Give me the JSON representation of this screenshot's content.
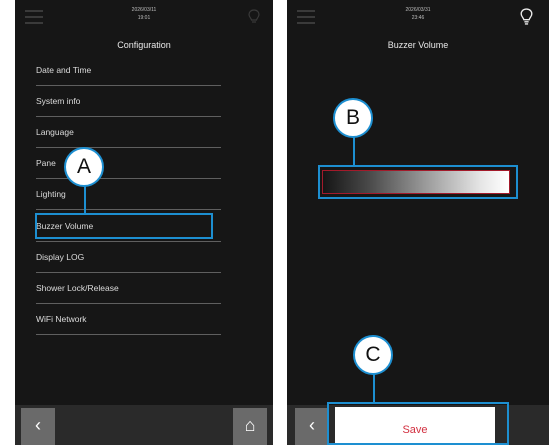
{
  "colors": {
    "accent": "#1d8fd1",
    "save_text": "#d23040",
    "background": "#161616"
  },
  "left_screen": {
    "date": "2026/03/11",
    "time": "19:01",
    "title": "Configuration",
    "menu": [
      {
        "label": "Date and Time"
      },
      {
        "label": "System info"
      },
      {
        "label": "Language"
      },
      {
        "label": "Pane"
      },
      {
        "label": "Lighting"
      },
      {
        "label": "Buzzer Volume"
      },
      {
        "label": "Display LOG"
      },
      {
        "label": "Shower Lock/Release"
      },
      {
        "label": "WiFi Network"
      }
    ],
    "back_icon": "‹",
    "home_icon": "⌂"
  },
  "right_screen": {
    "date": "2026/03/31",
    "time": "23:46",
    "title": "Buzzer Volume",
    "save_label": "Save",
    "back_icon": "‹"
  },
  "callouts": {
    "a": "A",
    "b": "B",
    "c": "C"
  }
}
